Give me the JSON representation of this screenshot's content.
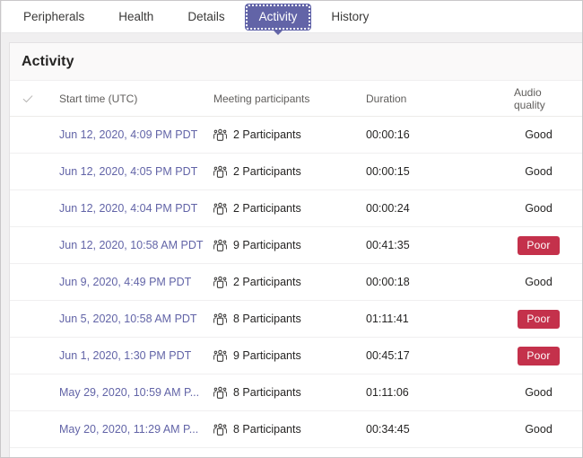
{
  "tabs": [
    {
      "label": "Peripherals",
      "active": false
    },
    {
      "label": "Health",
      "active": false
    },
    {
      "label": "Details",
      "active": false
    },
    {
      "label": "Activity",
      "active": true
    },
    {
      "label": "History",
      "active": false
    }
  ],
  "panel": {
    "title": "Activity"
  },
  "table": {
    "columns": {
      "select": "",
      "start_time": "Start time (UTC)",
      "participants": "Meeting participants",
      "duration": "Duration",
      "audio_quality": "Audio quality"
    },
    "rows": [
      {
        "start_time": "Jun 12, 2020, 4:09 PM PDT",
        "participants": "2 Participants",
        "duration": "00:00:16",
        "audio_quality": "Good",
        "quality_badge": false
      },
      {
        "start_time": "Jun 12, 2020, 4:05 PM PDT",
        "participants": "2 Participants",
        "duration": "00:00:15",
        "audio_quality": "Good",
        "quality_badge": false
      },
      {
        "start_time": "Jun 12, 2020, 4:04 PM PDT",
        "participants": "2 Participants",
        "duration": "00:00:24",
        "audio_quality": "Good",
        "quality_badge": false
      },
      {
        "start_time": "Jun 12, 2020, 10:58 AM PDT",
        "participants": "9 Participants",
        "duration": "00:41:35",
        "audio_quality": "Poor",
        "quality_badge": true
      },
      {
        "start_time": "Jun 9, 2020, 4:49 PM PDT",
        "participants": "2 Participants",
        "duration": "00:00:18",
        "audio_quality": "Good",
        "quality_badge": false
      },
      {
        "start_time": "Jun 5, 2020, 10:58 AM PDT",
        "participants": "8 Participants",
        "duration": "01:11:41",
        "audio_quality": "Poor",
        "quality_badge": true
      },
      {
        "start_time": "Jun 1, 2020, 1:30 PM PDT",
        "participants": "9 Participants",
        "duration": "00:45:17",
        "audio_quality": "Poor",
        "quality_badge": true
      },
      {
        "start_time": "May 29, 2020, 10:59 AM P...",
        "participants": "8 Participants",
        "duration": "01:11:06",
        "audio_quality": "Good",
        "quality_badge": false
      },
      {
        "start_time": "May 20, 2020, 11:29 AM P...",
        "participants": "8 Participants",
        "duration": "00:34:45",
        "audio_quality": "Good",
        "quality_badge": false
      }
    ]
  },
  "icons": {
    "select_all": "check-icon",
    "participants": "people-group-icon"
  },
  "colors": {
    "accent": "#6264a7",
    "link": "#6264a7",
    "badge_poor": "#c4314b",
    "panel_header_bg": "#faf9f9",
    "page_bg": "#f0eff0"
  }
}
